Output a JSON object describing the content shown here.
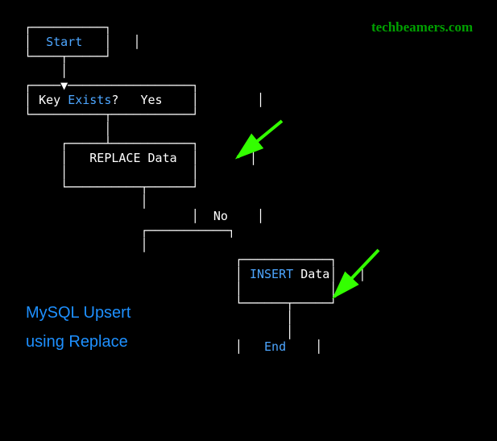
{
  "watermark": "techbeamers.com",
  "caption_line1": "MySQL Upsert",
  "caption_line2": "using Replace",
  "flow": {
    "start": "Start",
    "key_label": "Key",
    "exists_label": "Exists",
    "question": "?",
    "yes": "Yes",
    "replace_label": "REPLACE",
    "replace_data": "Data",
    "no": "No",
    "insert_label": "INSERT",
    "insert_data": "Data",
    "end": "End"
  }
}
